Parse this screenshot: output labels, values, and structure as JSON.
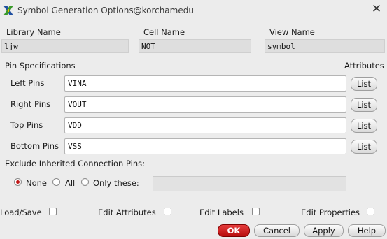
{
  "window": {
    "title": "Symbol Generation Options@korchamedu",
    "app_icon": "x-logo-icon",
    "close_icon": "close-icon"
  },
  "header": {
    "library_label": "Library Name",
    "library_value": "ljw",
    "cell_label": "Cell Name",
    "cell_value": "NOT",
    "view_label": "View Name",
    "view_value": "symbol"
  },
  "pins": {
    "section_label": "Pin Specifications",
    "attributes_label": "Attributes",
    "rows": [
      {
        "label": "Left Pins",
        "value": "VINA",
        "button": "List"
      },
      {
        "label": "Right Pins",
        "value": "VOUT",
        "button": "List"
      },
      {
        "label": "Top Pins",
        "value": "VDD",
        "button": "List"
      },
      {
        "label": "Bottom Pins",
        "value": "VSS",
        "button": "List"
      }
    ]
  },
  "exclude": {
    "label": "Exclude Inherited Connection Pins:",
    "options": [
      "None",
      "All",
      "Only these:"
    ],
    "selected": "None",
    "only_these_value": ""
  },
  "checks": [
    {
      "label": "Load/Save",
      "checked": false
    },
    {
      "label": "Edit Attributes",
      "checked": false
    },
    {
      "label": "Edit Labels",
      "checked": false
    },
    {
      "label": "Edit Properties",
      "checked": false
    }
  ],
  "buttons": {
    "ok": "OK",
    "cancel": "Cancel",
    "apply": "Apply",
    "help": "Help",
    "ok_color": "#c41a1a"
  }
}
